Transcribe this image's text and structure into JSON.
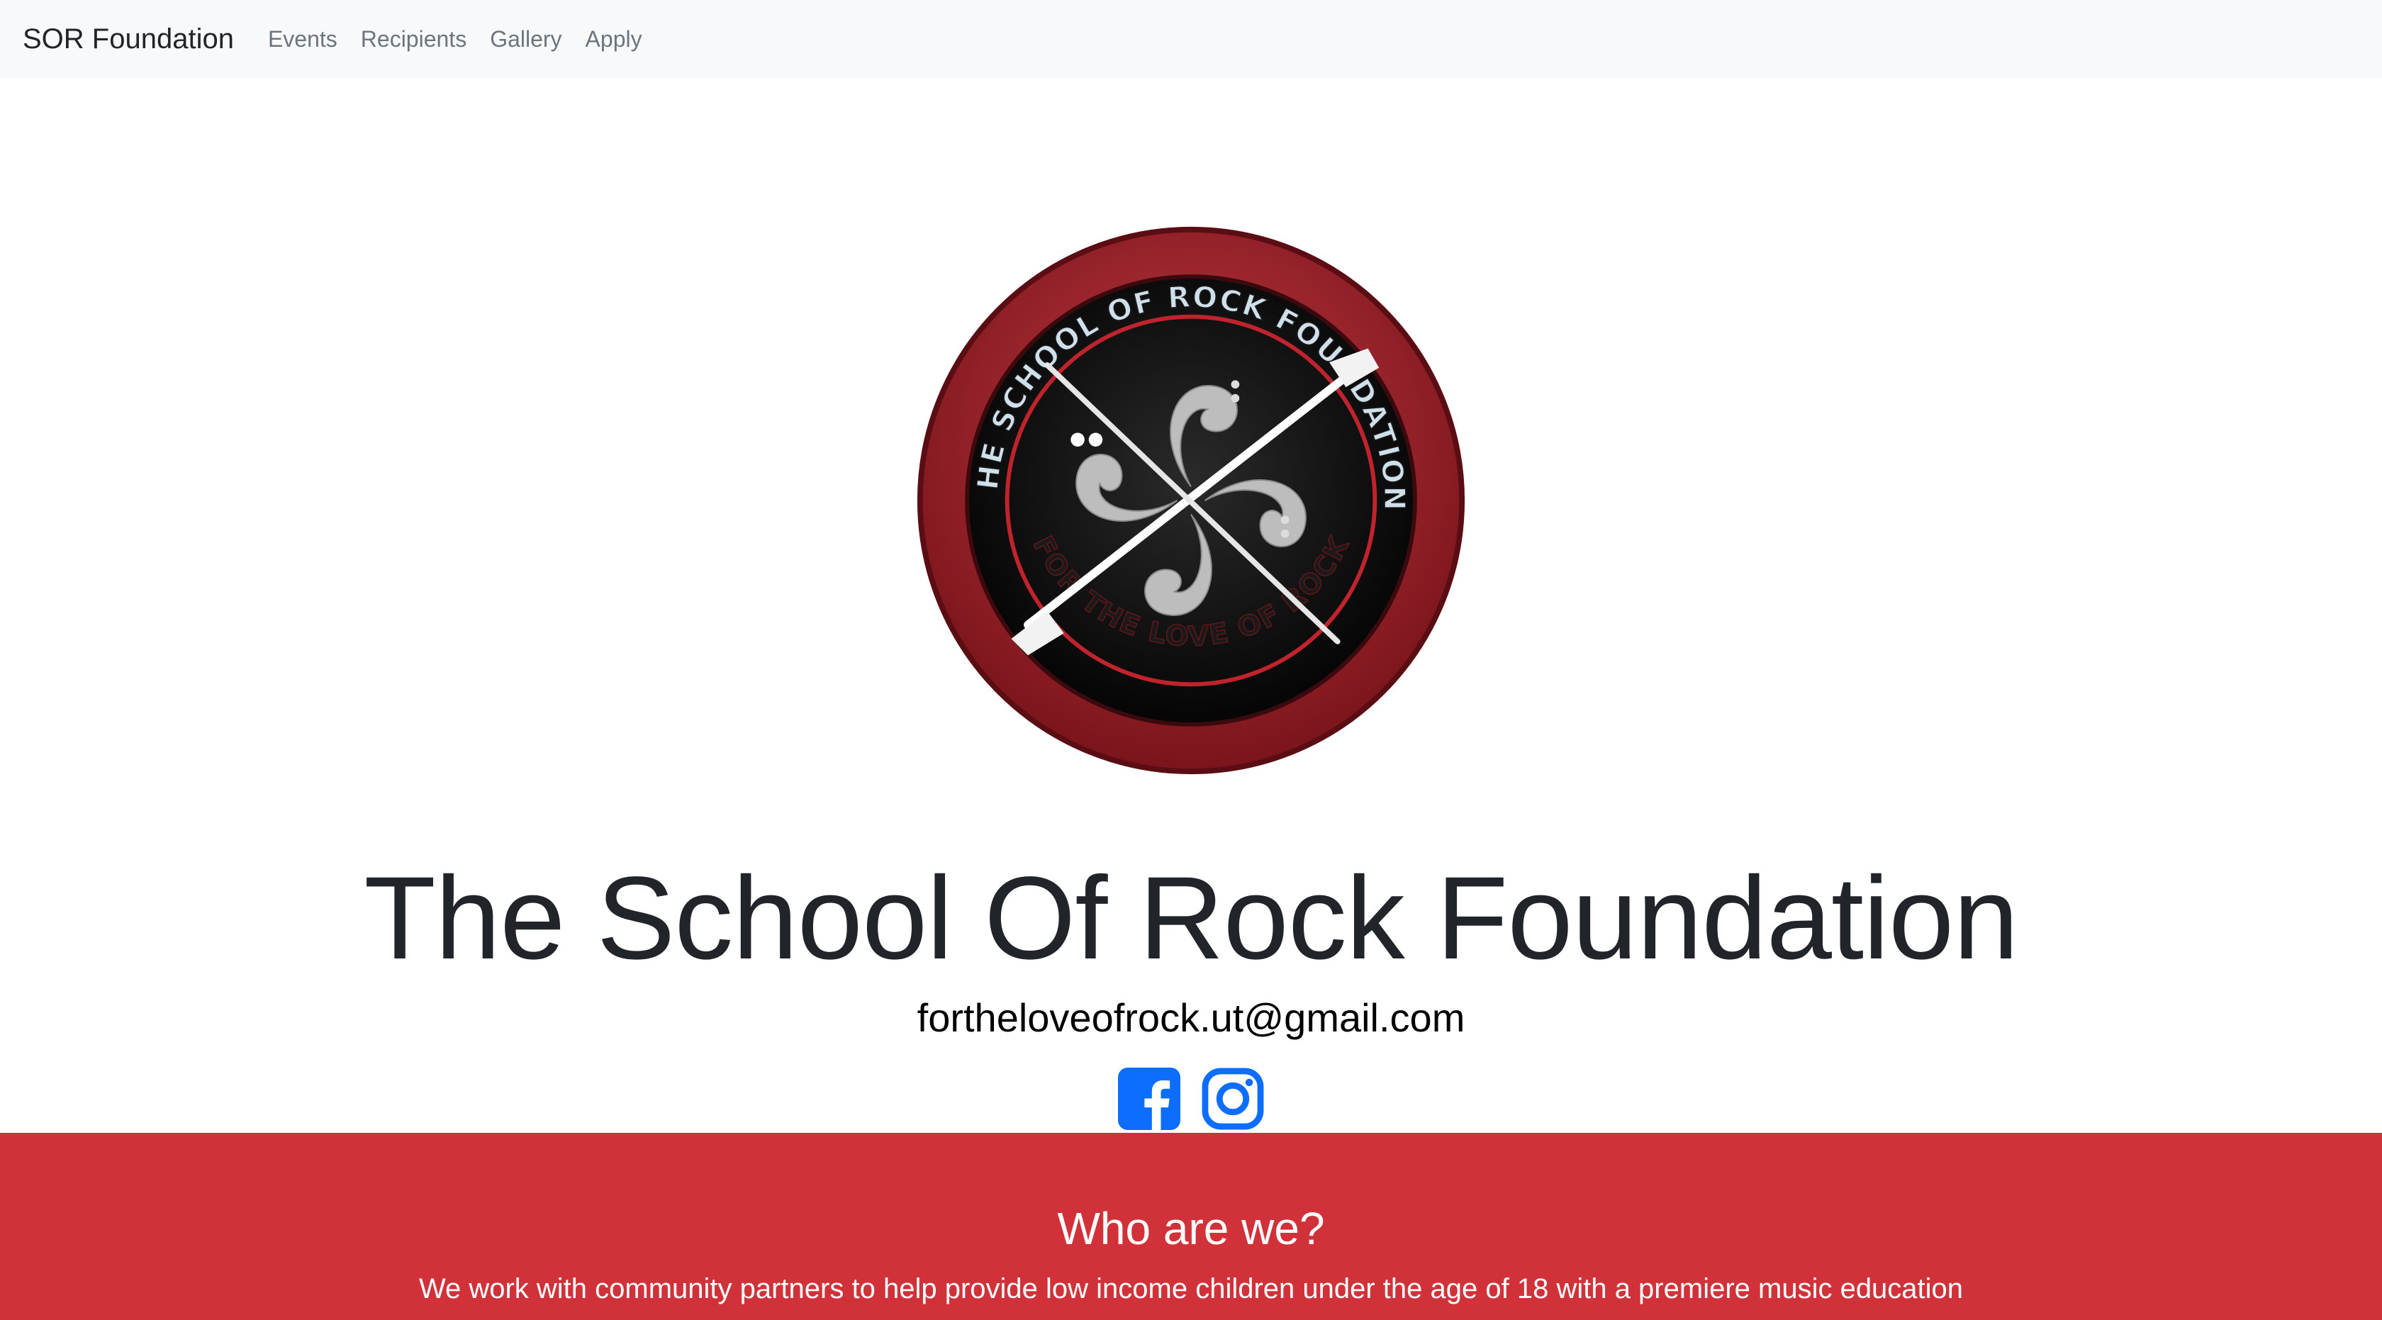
{
  "navbar": {
    "brand": "SOR Foundation",
    "links": [
      "Events",
      "Recipients",
      "Gallery",
      "Apply"
    ]
  },
  "hero": {
    "logo": {
      "ring_text_top": "THE SCHOOL OF ROCK FOUNDATION",
      "ring_text_bottom": "FOR THE LOVE OF ROCK"
    },
    "title": "The School Of Rock Foundation",
    "email": "fortheloveofrock.ut@gmail.com",
    "social_icons": [
      "facebook-icon",
      "instagram-icon"
    ]
  },
  "about": {
    "heading": "Who are we?",
    "text": "We work with community partners to help provide low income children under the age of 18 with a premiere music education"
  },
  "colors": {
    "navbar_bg": "#f8f9fa",
    "accent_red": "#d13239",
    "social_blue": "#0d6efd"
  }
}
